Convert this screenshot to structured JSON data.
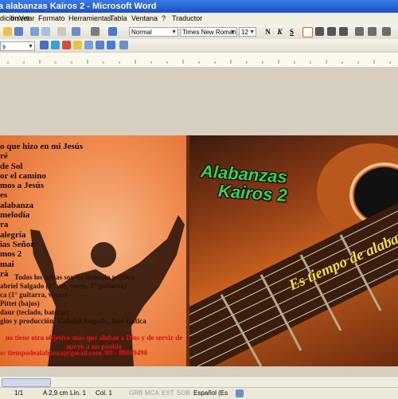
{
  "window": {
    "title": "a alabanzas Kairos 2 - Microsoft Word"
  },
  "menu": {
    "items": [
      "dición",
      "Ver",
      "Insertar",
      "Formato",
      "Herramientas",
      "Tabla",
      "Ventana",
      "?",
      "Traductor"
    ]
  },
  "toolbar": {
    "style": "Normal",
    "font": "Times New Roman",
    "size": "12",
    "bold": "N",
    "italic": "K",
    "underline": "S"
  },
  "ruler": {
    "left_label": "s"
  },
  "document": {
    "songs": [
      "o que hizo en mi Jesús",
      "ré",
      "de Sol",
      "or el camino",
      "mos a Jesús",
      "es",
      " alabanza",
      " melodía",
      "ra",
      "alegría",
      "ias Señor",
      "mos 2",
      "mai",
      "rá"
    ],
    "credits": [
      "Todos los temas son de dominio público",
      "abriel Salgado (1° voz, voces, 2° guitarra)",
      "ca (1° guitarra, voces)",
      " Pittet (bajos)",
      "daur (teclado, batería)",
      "glos y producción: Gabriel Salgado, José Gatica"
    ],
    "note": "no tiene otro objetivo más que alabar a Dios y de servir de apoyo a un pueblo",
    "contact": "o: tiempodealabanza@gmail.com /09 - 88869490",
    "title_line1": "Alabanzas",
    "title_line2": "Kairos 2",
    "tagline": "Es tiempo de alaba"
  },
  "status": {
    "page": "1/1",
    "position": "A 2,9 cm",
    "line": "Lín. 1",
    "col": "Col. 1",
    "grb": "GRB",
    "mca": "MCA",
    "ext": "EXT",
    "sob": "SOB",
    "language": "Español (Es"
  }
}
